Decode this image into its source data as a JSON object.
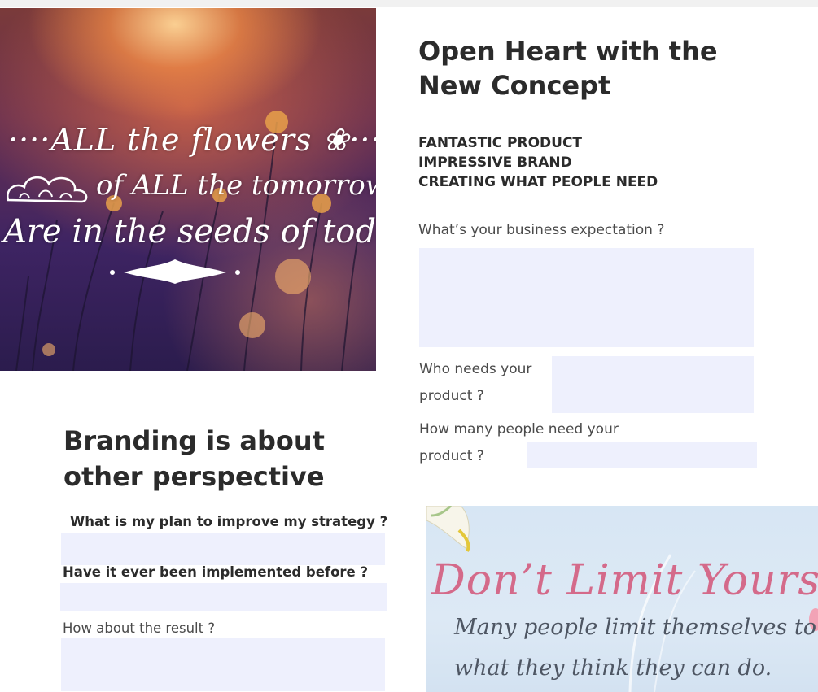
{
  "hero_image": {
    "quote_line1": "····ALL the flowers ❀···",
    "quote_line2": "of ALL the tomorrows",
    "quote_line3": "Are in the seeds of today··"
  },
  "header": {
    "title": "Open Heart with the New Concept",
    "features": [
      "FANTASTIC PRODUCT",
      "IMPRESSIVE BRAND",
      "CREATING WHAT PEOPLE NEED"
    ]
  },
  "questions_right": {
    "q1": "What’s your business expectation ?",
    "q2_line1": "Who needs your",
    "q2_line2": "product ?",
    "q3_line1": "How many people need your",
    "q3_line2": "product ?"
  },
  "branding": {
    "title": "Branding is about other perspective",
    "q1": "What is my plan to improve my strategy ?",
    "q2": "Have it ever been implemented before ?",
    "q3": "How about the result ?"
  },
  "motivation_image": {
    "headline": "Don’t Limit Yourself",
    "line1": "Many people limit themselves to",
    "line2": "what they think they can do."
  },
  "colors": {
    "field_background": "#eef0fd",
    "headline_pink": "#d46a8a",
    "panel_blue": "#d7e6f4"
  }
}
